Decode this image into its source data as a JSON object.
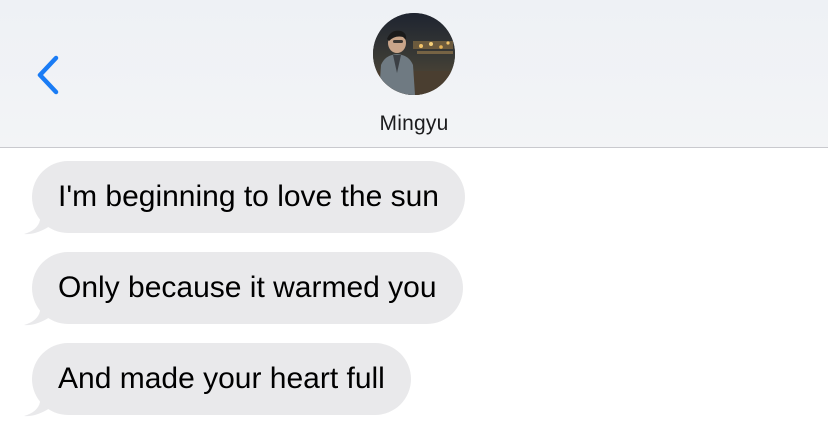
{
  "header": {
    "contact_name": "Mingyu",
    "avatar_icon": "contact-photo",
    "back_icon": "chevron-left-icon",
    "accent_color": "#1a7cf5"
  },
  "messages": [
    {
      "text": "I'm beginning to love the sun",
      "direction": "incoming"
    },
    {
      "text": "Only because it warmed you",
      "direction": "incoming"
    },
    {
      "text": "And made your heart full",
      "direction": "incoming"
    }
  ],
  "colors": {
    "incoming_bubble": "#e9e9eb",
    "text": "#000000"
  }
}
